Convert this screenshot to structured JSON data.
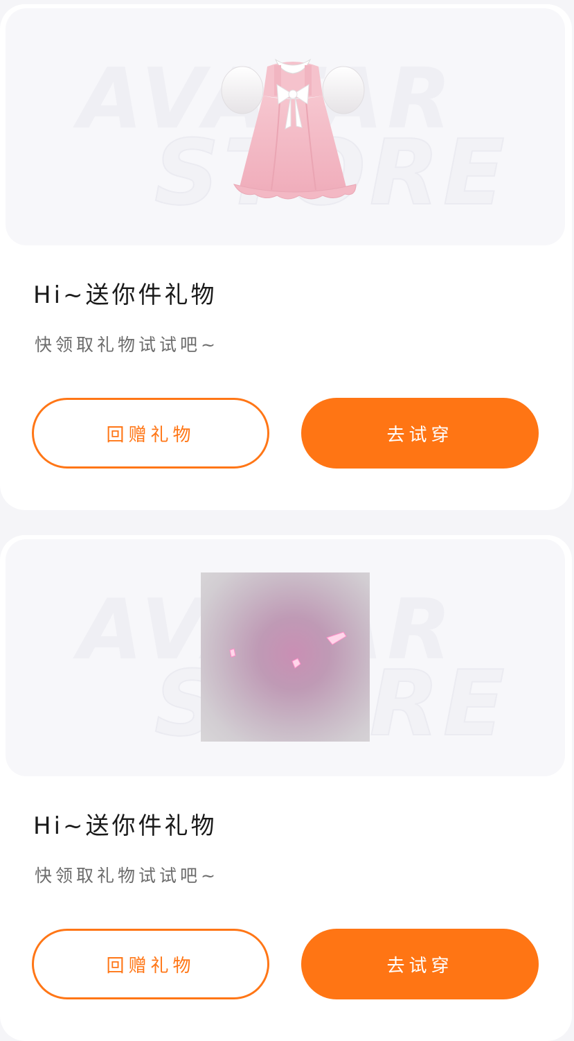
{
  "colors": {
    "accent": "#ff7514",
    "background": "#f5f5f8",
    "card": "#ffffff",
    "title_text": "#1a1a1a",
    "subtitle_text": "#6c6c6c"
  },
  "watermark": {
    "line1": "AVATAR",
    "line2": "STORE"
  },
  "cards": [
    {
      "image": "pink-dress-image",
      "title": "Hi~送你件礼物",
      "subtitle": "快领取礼物试试吧~",
      "return_gift_label": "回赠礼物",
      "try_on_label": "去试穿"
    },
    {
      "image": "pink-sparkle-effect-image",
      "title": "Hi~送你件礼物",
      "subtitle": "快领取礼物试试吧~",
      "return_gift_label": "回赠礼物",
      "try_on_label": "去试穿"
    }
  ]
}
